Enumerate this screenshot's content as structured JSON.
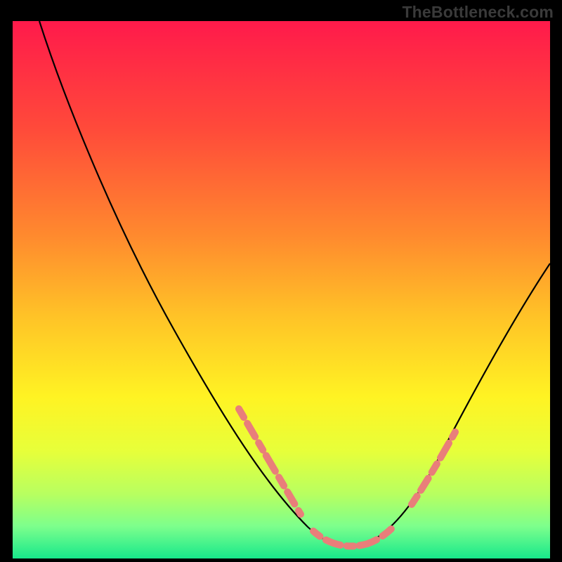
{
  "attribution": "TheBottleneck.com",
  "chart_data": {
    "type": "line",
    "title": "",
    "xlabel": "",
    "ylabel": "",
    "xlim": [
      0,
      100
    ],
    "ylim": [
      0,
      100
    ],
    "grid": false,
    "legend": false,
    "background": {
      "type": "vertical-gradient",
      "stops": [
        {
          "pos": 0.0,
          "color": "#ff1a4b"
        },
        {
          "pos": 0.2,
          "color": "#ff4a3a"
        },
        {
          "pos": 0.4,
          "color": "#ff8a2e"
        },
        {
          "pos": 0.55,
          "color": "#ffc327"
        },
        {
          "pos": 0.7,
          "color": "#fff323"
        },
        {
          "pos": 0.8,
          "color": "#e7ff3a"
        },
        {
          "pos": 0.88,
          "color": "#b8ff60"
        },
        {
          "pos": 0.94,
          "color": "#7dff8c"
        },
        {
          "pos": 1.0,
          "color": "#17e88b"
        }
      ]
    },
    "series": [
      {
        "name": "curve",
        "color": "#000000",
        "x": [
          5,
          10,
          15,
          20,
          25,
          30,
          35,
          40,
          45,
          50,
          53,
          56,
          59,
          62,
          65,
          68,
          72,
          76,
          80,
          85,
          90,
          95,
          100
        ],
        "y": [
          100,
          90,
          80,
          70,
          60,
          50,
          41,
          33,
          25,
          17,
          12,
          8,
          5,
          3,
          2,
          3,
          7,
          13,
          20,
          28,
          37,
          46,
          55
        ]
      },
      {
        "name": "highlight-left",
        "color": "#e97e7a",
        "style": "dashed-thick",
        "x": [
          43,
          45,
          47,
          49,
          51,
          53,
          55
        ],
        "y": [
          28,
          25,
          22,
          19,
          16,
          13,
          10
        ]
      },
      {
        "name": "highlight-bottom",
        "color": "#e97e7a",
        "style": "dashed-thick",
        "x": [
          56,
          58,
          60,
          62,
          64,
          66,
          68
        ],
        "y": [
          6,
          4,
          3,
          2,
          2,
          3,
          4
        ]
      },
      {
        "name": "highlight-right",
        "color": "#e97e7a",
        "style": "dashed-thick",
        "x": [
          72,
          74,
          76,
          78,
          80
        ],
        "y": [
          10,
          13,
          16,
          19,
          22
        ]
      }
    ]
  }
}
